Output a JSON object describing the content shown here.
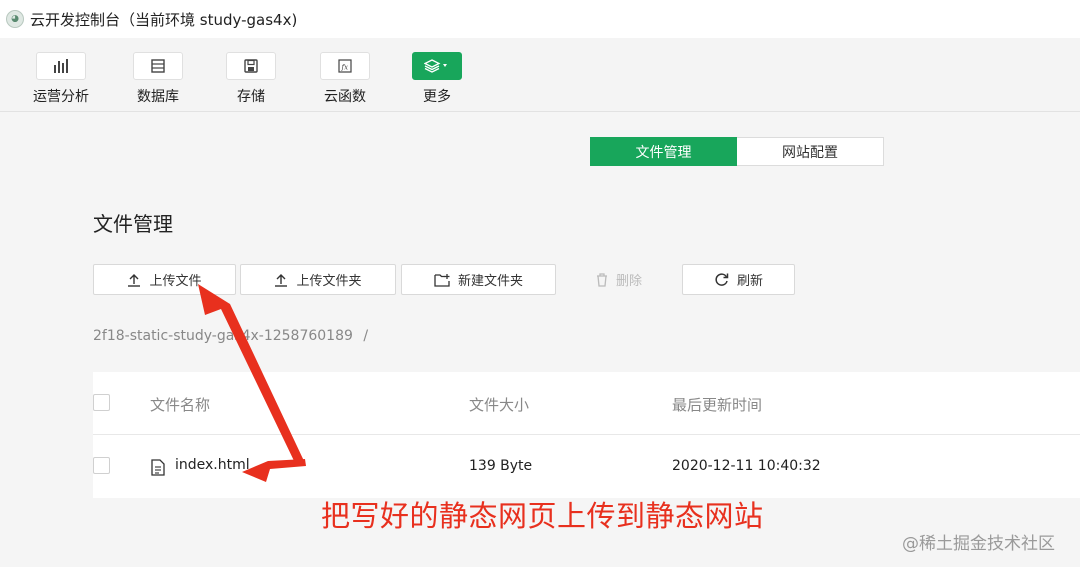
{
  "window": {
    "title": "云开发控制台（当前环境 study-gas4x)",
    "logo_icon": "wechat-devtools-icon"
  },
  "toolbar": {
    "items": [
      {
        "label": "运营分析",
        "icon": "bar-chart-icon"
      },
      {
        "label": "数据库",
        "icon": "database-icon"
      },
      {
        "label": "存储",
        "icon": "save-icon"
      },
      {
        "label": "云函数",
        "icon": "function-icon"
      },
      {
        "label": "更多",
        "icon": "layers-icon"
      }
    ],
    "accent": "#18a65b"
  },
  "tabs": [
    {
      "label": "文件管理",
      "active": true
    },
    {
      "label": "网站配置",
      "active": false
    }
  ],
  "page": {
    "title": "文件管理"
  },
  "actions": {
    "upload_file": "上传文件",
    "upload_folder": "上传文件夹",
    "new_folder": "新建文件夹",
    "delete": "删除",
    "refresh": "刷新"
  },
  "breadcrumb": {
    "path": "2f18-static-study-gas4x-1258760189",
    "separator": "/"
  },
  "table": {
    "columns": [
      "文件名称",
      "文件大小",
      "最后更新时间"
    ],
    "rows": [
      {
        "name": "index.html",
        "size": "139 Byte",
        "updated": "2020-12-11 10:40:32"
      }
    ]
  },
  "annotation": {
    "caption": "把写好的静态网页上传到静态网站",
    "color": "#e8301e"
  },
  "watermark": "@稀土掘金技术社区"
}
